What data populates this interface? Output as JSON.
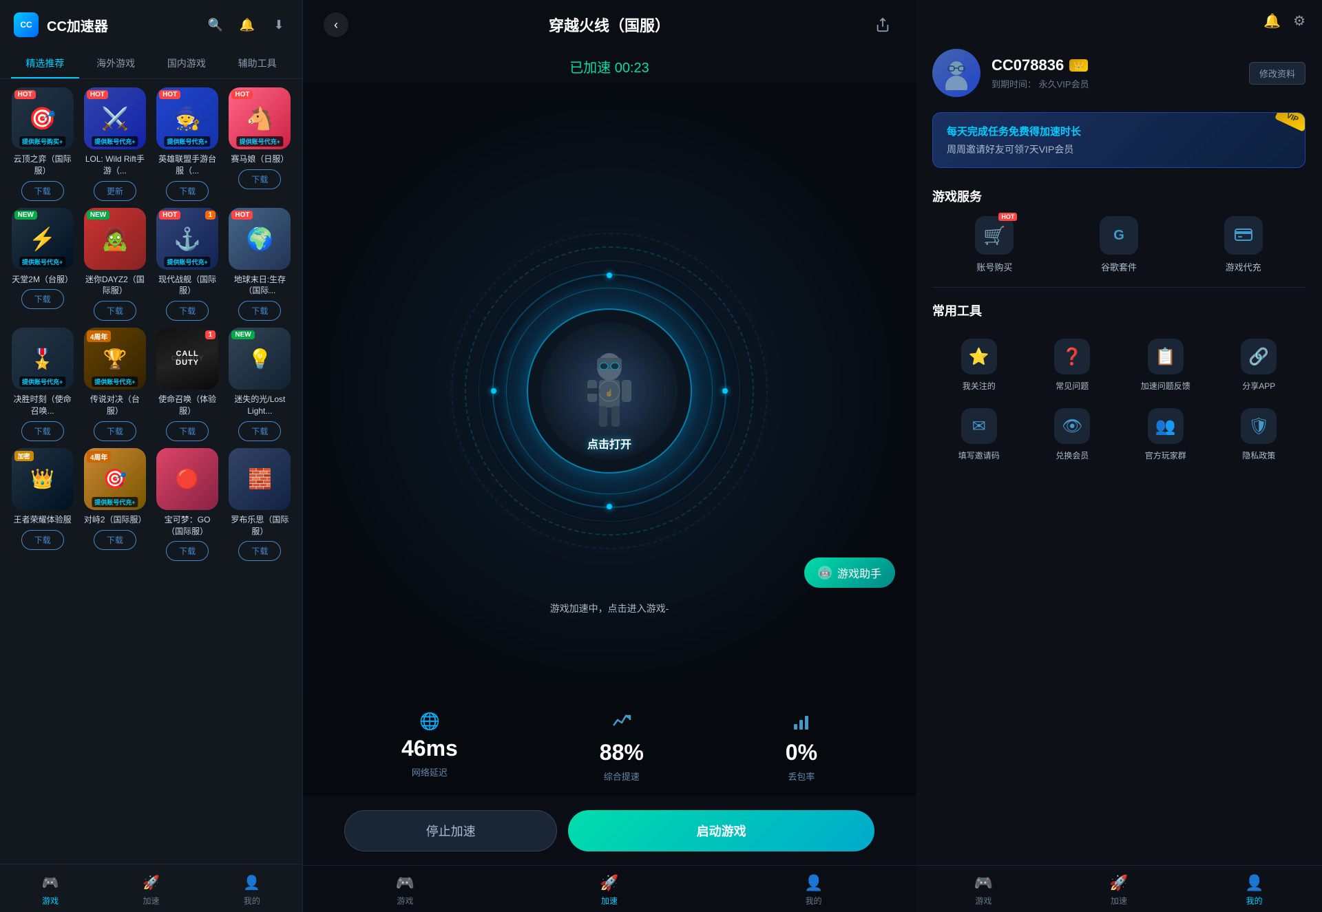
{
  "app": {
    "title": "CC加速器",
    "logo": "CC"
  },
  "header": {
    "search_icon": "🔍",
    "notification_icon": "🔔",
    "download_icon": "⬇"
  },
  "nav_tabs": [
    {
      "id": "featured",
      "label": "精选推荐",
      "active": true
    },
    {
      "id": "overseas",
      "label": "海外游戏"
    },
    {
      "id": "domestic",
      "label": "国内游戏"
    },
    {
      "id": "tools",
      "label": "辅助工具"
    }
  ],
  "games": [
    {
      "id": 1,
      "name": "云顶之弈（国际服）",
      "badge": "HOT",
      "badge_type": "hot",
      "btn": "下载",
      "sub_badge": "提供账号购买+",
      "thumb_class": "thumb-1"
    },
    {
      "id": 2,
      "name": "LOL: Wild Rift手游（...",
      "badge": "HOT",
      "badge_type": "hot",
      "btn": "更新",
      "sub_badge": "提供账号代充+",
      "thumb_class": "thumb-2"
    },
    {
      "id": 3,
      "name": "英雄联盟手游台服（...",
      "badge": "HOT",
      "badge_type": "hot",
      "btn": "下载",
      "sub_badge": "提供账号代充+",
      "thumb_class": "thumb-3"
    },
    {
      "id": 4,
      "name": "赛马娘（日服）",
      "badge": "HOT",
      "badge_type": "hot",
      "btn": "下载",
      "sub_badge": "提供账号代充+",
      "thumb_class": "thumb-4"
    },
    {
      "id": 5,
      "name": "天堂2M（台服）",
      "badge": "NEW",
      "badge_type": "new",
      "btn": "下载",
      "sub_badge": "提供账号代充+",
      "thumb_class": "thumb-5"
    },
    {
      "id": 6,
      "name": "迷你DAYZ2（国际服）",
      "badge": "NEW",
      "badge_type": "new",
      "btn": "下载",
      "sub_badge": "",
      "thumb_class": "thumb-6"
    },
    {
      "id": 7,
      "name": "现代战舰（国际服）",
      "badge": "HOT",
      "badge_type": "hot",
      "btn": "下载",
      "sub_badge": "提供账号代充+",
      "thumb_class": "thumb-7",
      "num_badge": "1"
    },
    {
      "id": 8,
      "name": "地球末日:生存（国际...",
      "badge": "HOT",
      "badge_type": "hot",
      "btn": "下载",
      "sub_badge": "",
      "thumb_class": "thumb-8"
    },
    {
      "id": 9,
      "name": "决胜时刻（使命召唤...",
      "badge": "",
      "btn": "下载",
      "sub_badge": "提供账号代充+",
      "thumb_class": "thumb-9"
    },
    {
      "id": 10,
      "name": "传说对决（台服）",
      "badge": "4周年",
      "badge_type": "anniversary",
      "btn": "下载",
      "sub_badge": "提供账号代充+",
      "thumb_class": "thumb-10"
    },
    {
      "id": 11,
      "name": "使命召唤（体验服）",
      "badge": "1",
      "badge_type": "number",
      "btn": "下载",
      "sub_badge": "",
      "thumb_class": "call-duty-visual",
      "is_call_duty": true
    },
    {
      "id": 12,
      "name": "迷失的光/Lost Light...",
      "badge": "NEW",
      "badge_type": "new",
      "btn": "下载",
      "sub_badge": "",
      "thumb_class": "thumb-12"
    },
    {
      "id": 13,
      "name": "王者荣耀体验服",
      "badge": "加密",
      "badge_type": "hot",
      "btn": "下载",
      "sub_badge": "",
      "thumb_class": "thumb-13"
    },
    {
      "id": 14,
      "name": "对峙2（国际服）",
      "badge": "4周年",
      "badge_type": "anniversary",
      "btn": "下载",
      "sub_badge": "提供账号代充+",
      "thumb_class": "thumb-14"
    },
    {
      "id": 15,
      "name": "宝可梦：GO（国际服）",
      "badge": "",
      "btn": "下载",
      "sub_badge": "",
      "thumb_class": "thumb-15"
    },
    {
      "id": 16,
      "name": "罗布乐思（国际服）",
      "badge": "",
      "btn": "下载",
      "sub_badge": "",
      "thumb_class": "thumb-16"
    }
  ],
  "bottom_nav_left": [
    {
      "id": "games",
      "label": "游戏",
      "icon": "🎮",
      "active": true
    },
    {
      "id": "speed",
      "label": "加速",
      "icon": "🚀"
    },
    {
      "id": "profile",
      "label": "我的",
      "icon": "👤"
    }
  ],
  "middle": {
    "back_icon": "‹",
    "game_title": "穿越火线（国服）",
    "share_icon": "↗",
    "status_text": "已加速 00:23",
    "click_prompt": "点击打开",
    "loading_text": "游戏加速中，点击进入游戏-",
    "assistant_label": "游戏助手",
    "stats": [
      {
        "icon": "🌐",
        "value": "46ms",
        "label": "网络延迟"
      },
      {
        "icon": "📈",
        "value": "88%",
        "label": "综合提速"
      },
      {
        "icon": "📊",
        "value": "0%",
        "label": "丢包率"
      }
    ],
    "btn_stop": "停止加速",
    "btn_start": "启动游戏"
  },
  "middle_bottom_nav": [
    {
      "id": "games",
      "label": "游戏",
      "icon": "🎮"
    },
    {
      "id": "speed",
      "label": "加速",
      "icon": "🚀",
      "active": true
    },
    {
      "id": "profile",
      "label": "我的",
      "icon": "👤"
    }
  ],
  "right": {
    "notification_icon": "🔔",
    "settings_icon": "⚙",
    "user": {
      "username": "CC078836",
      "vip_badge": "👑",
      "expiry_label": "到期时间：",
      "expiry_value": "永久VIP会员",
      "edit_btn": "修改资料"
    },
    "promo": {
      "line1": "每天完成任务免费得加速时长",
      "line2": "周周邀请好友可领7天VIP会员"
    },
    "game_services": {
      "title": "游戏服务",
      "items": [
        {
          "id": "shop",
          "label": "账号购买",
          "icon": "🛒",
          "hot": true
        },
        {
          "id": "google",
          "label": "谷歌套件",
          "icon": "G"
        },
        {
          "id": "topup",
          "label": "游戏代充",
          "icon": "💳"
        }
      ]
    },
    "tools": {
      "title": "常用工具",
      "items": [
        {
          "id": "following",
          "label": "我关注的",
          "icon": "⭐"
        },
        {
          "id": "faq",
          "label": "常见问题",
          "icon": "❓"
        },
        {
          "id": "feedback",
          "label": "加速问题反馈",
          "icon": "📋"
        },
        {
          "id": "share",
          "label": "分享APP",
          "icon": "🔗"
        },
        {
          "id": "invite",
          "label": "填写邀请码",
          "icon": "✉"
        },
        {
          "id": "exchange",
          "label": "兑换会员",
          "icon": "👁"
        },
        {
          "id": "community",
          "label": "官方玩家群",
          "icon": "👥"
        },
        {
          "id": "privacy",
          "label": "隐私政策",
          "icon": "🛡"
        }
      ]
    },
    "bottom_nav": [
      {
        "id": "games",
        "label": "游戏",
        "icon": "🎮"
      },
      {
        "id": "speed",
        "label": "加速",
        "icon": "🚀"
      },
      {
        "id": "profile",
        "label": "我的",
        "icon": "👤",
        "active": true
      }
    ]
  }
}
